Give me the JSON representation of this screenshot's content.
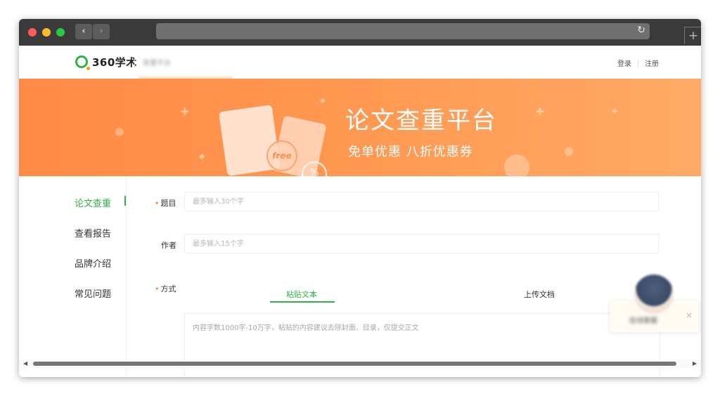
{
  "browser": {
    "back_icon": "chevron-left",
    "forward_icon": "chevron-right",
    "reload_icon": "reload",
    "new_tab_icon": "plus"
  },
  "header": {
    "logo_text": "360学术",
    "sub_title": "查重平台",
    "login_label": "登录",
    "register_label": "注册"
  },
  "banner": {
    "title": "论文查重平台",
    "subtitle": "免单优惠   八折优惠券",
    "ticket_text": "free",
    "percent_text": "%"
  },
  "sidebar": {
    "items": [
      {
        "label": "论文查重",
        "active": true
      },
      {
        "label": "查看报告",
        "active": false
      },
      {
        "label": "品牌介绍",
        "active": false
      },
      {
        "label": "常见问题",
        "active": false
      }
    ]
  },
  "form": {
    "required_mark": "•",
    "title_label": "题目",
    "title_placeholder": "最多输入30个字",
    "author_label": "作者",
    "author_placeholder": "最多输入15个字",
    "mode_label": "方式",
    "mode_tabs": [
      {
        "label": "粘贴文本",
        "active": true
      },
      {
        "label": "上传文档",
        "active": false
      }
    ],
    "text_placeholder": "内容字数1000字-10万字，粘贴的内容建议去除封面、目录，仅提交正文"
  },
  "support_widget": {
    "text": "在线客服",
    "close_icon": "close"
  },
  "colors": {
    "accent": "#2fb245",
    "banner": "#ff9a53",
    "required": "#ff7b2e"
  }
}
